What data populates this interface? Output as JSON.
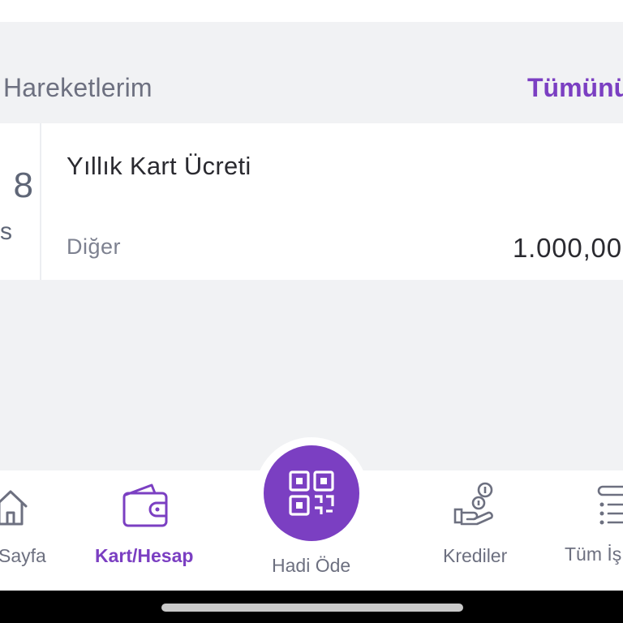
{
  "section": {
    "title": "Hareketlerim",
    "see_all_label": "Tümünü"
  },
  "transaction": {
    "date_day": "8",
    "date_month": "s",
    "title": "Yıllık Kart Ücreti",
    "category": "Diğer",
    "amount": "1.000,00"
  },
  "bottom_nav": {
    "items": [
      {
        "label": "Sayfa",
        "icon": "home-icon",
        "active": false
      },
      {
        "label": "Kart/Hesap",
        "icon": "wallet-icon",
        "active": true
      },
      {
        "label": "Hadi Öde",
        "icon": "qr-code-icon",
        "active": false
      },
      {
        "label": "Krediler",
        "icon": "hand-coins-icon",
        "active": false
      },
      {
        "label": "Tüm İş",
        "icon": "list-icon",
        "active": false
      }
    ]
  },
  "colors": {
    "accent": "#7b3fc2",
    "text_muted": "#6d7080",
    "text_dark": "#2a2a30",
    "background": "#f1f2f4"
  }
}
